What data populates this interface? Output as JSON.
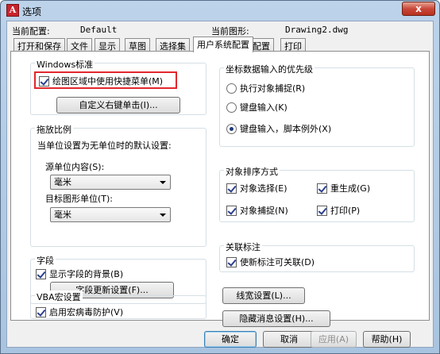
{
  "window": {
    "title": "选项",
    "close_label": "x"
  },
  "config": {
    "current_profile_label": "当前配置:",
    "current_profile_value": "Default",
    "current_drawing_label": "当前图形:",
    "current_drawing_value": "Drawing2.dwg"
  },
  "tabs": [
    "打开和保存",
    "文件",
    "显示",
    "草图",
    "选择集",
    "用户系统配置",
    "配置",
    "打印"
  ],
  "active_tab": "用户系统配置",
  "windows_std": {
    "title": "Windows标准",
    "shortcut_menu": "绘图区域中使用快捷菜单(M)",
    "shortcut_menu_checked": true,
    "right_click_button": "自定义右键单击(I)..."
  },
  "scale": {
    "title": "拖放比例",
    "desc": "当单位设置为无单位时的默认设置:",
    "source_label": "源单位内容(S):",
    "source_value": "毫米",
    "target_label": "目标图形单位(T):",
    "target_value": "毫米"
  },
  "fields": {
    "title": "字段",
    "show_bg": "显示字段的背景(B)",
    "show_bg_checked": true,
    "update_button": "字段更新设置(F)..."
  },
  "vba": {
    "title": "VBA宏设置",
    "virus": "启用宏病毒防护(V)",
    "virus_checked": true
  },
  "coord": {
    "title": "坐标数据输入的优先级",
    "options": [
      "执行对象捕捉(R)",
      "键盘输入(K)",
      "键盘输入，脚本例外(X)"
    ],
    "selected": 2
  },
  "sort": {
    "title": "对象排序方式",
    "items": [
      {
        "label": "对象选择(E)",
        "checked": true
      },
      {
        "label": "重生成(G)",
        "checked": true
      },
      {
        "label": "对象捕捉(N)",
        "checked": true
      },
      {
        "label": "打印(P)",
        "checked": true
      }
    ]
  },
  "assoc": {
    "title": "关联标注",
    "new_assoc": "使新标注可关联(D)",
    "new_assoc_checked": true
  },
  "buttons": {
    "lineweight": "线宽设置(L)...",
    "hidden_msg": "隐藏消息设置(H)...",
    "ok": "确定",
    "cancel": "取消",
    "apply": "应用(A)",
    "help": "帮助(H)"
  }
}
